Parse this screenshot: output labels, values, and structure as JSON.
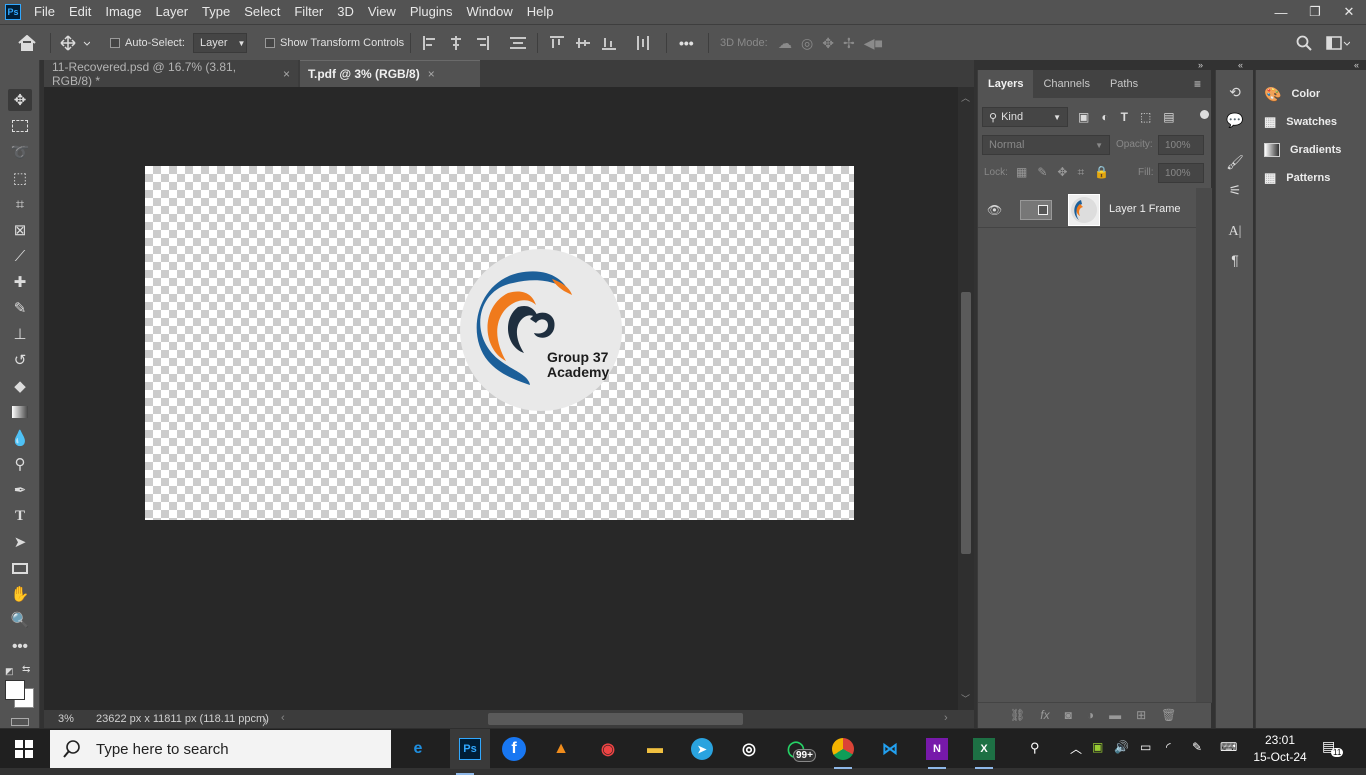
{
  "app": {
    "logo_text": "Ps",
    "menu": [
      "File",
      "Edit",
      "Image",
      "Layer",
      "Type",
      "Select",
      "Filter",
      "3D",
      "View",
      "Plugins",
      "Window",
      "Help"
    ],
    "window_controls": {
      "minimize": "—",
      "restore": "❐",
      "close": "✕"
    }
  },
  "options_bar": {
    "auto_select_label": "Auto-Select:",
    "auto_select_target": "Layer",
    "show_transform_label": "Show Transform Controls",
    "three_d_mode_label": "3D Mode:",
    "more": "•••"
  },
  "tabs": [
    {
      "label": "11-Recovered.psd @ 16.7% (3.81, RGB/8) *",
      "close": "×"
    },
    {
      "label": "T.pdf @ 3% (RGB/8)",
      "close": "×"
    }
  ],
  "canvas": {
    "logo_line1": "Group 37",
    "logo_line2": "Academy"
  },
  "status": {
    "zoom": "3%",
    "dimensions": "23622 px x 11811 px (118.11 ppcm)",
    "arrow": "〉"
  },
  "layers_panel": {
    "tabs": [
      "Layers",
      "Channels",
      "Paths"
    ],
    "filter_kind": "Kind",
    "blend_mode": "Normal",
    "opacity_label": "Opacity:",
    "opacity_value": "100%",
    "lock_label": "Lock:",
    "fill_label": "Fill:",
    "fill_value": "100%",
    "layers": [
      {
        "name": "Layer 1 Frame",
        "visible": true
      }
    ]
  },
  "right_panels": {
    "items": [
      "Color",
      "Swatches",
      "Gradients",
      "Patterns"
    ]
  },
  "taskbar": {
    "search_placeholder": "Type here to search",
    "whatsapp_badge": "99+",
    "time": "23:01",
    "date": "15-Oct-24",
    "notification_count": "11"
  },
  "colors": {
    "ps_blue": "#31a8ff",
    "panel_bg": "#535353",
    "canvas_bg": "#282828",
    "taskbar_bg": "#202020"
  }
}
